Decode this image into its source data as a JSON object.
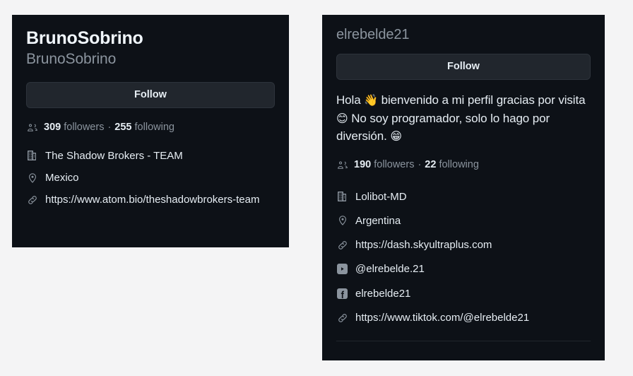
{
  "page": {
    "background_color": "#f4f4f5",
    "card_background_color": "#0d1117",
    "text_primary_color": "#e6edf3",
    "text_muted_color": "#8b949e"
  },
  "cards": [
    {
      "id": "brunosobrino",
      "display_name": "BrunoSobrino",
      "login_name": "BrunoSobrino",
      "follow_label": "Follow",
      "counts": {
        "followers_value": "309",
        "followers_label": "followers",
        "separator": "·",
        "following_value": "255",
        "following_label": "following"
      },
      "details": [
        {
          "icon": "organization-icon",
          "text": "The Shadow Brokers - TEAM"
        },
        {
          "icon": "location-icon",
          "text": "Mexico"
        },
        {
          "icon": "link-icon",
          "text": "https://www.atom.bio/theshadowbrokers-team"
        }
      ]
    },
    {
      "id": "elrebelde21",
      "login_name": "elrebelde21",
      "follow_label": "Follow",
      "bio": {
        "segment_1": "Hola ",
        "emoji_1": "👋",
        "segment_2": " bienvenido a mi perfil gracias por visita ",
        "emoji_2": "😊",
        "segment_3": " No soy programador, solo lo hago por diversión. ",
        "emoji_3": "😁"
      },
      "counts": {
        "followers_value": "190",
        "followers_label": "followers",
        "separator": "·",
        "following_value": "22",
        "following_label": "following"
      },
      "details": [
        {
          "icon": "organization-icon",
          "text": "Lolibot-MD"
        },
        {
          "icon": "location-icon",
          "text": "Argentina"
        },
        {
          "icon": "link-icon",
          "text": "https://dash.skyultraplus.com"
        },
        {
          "icon": "youtube-icon",
          "text": "@elrebelde.21"
        },
        {
          "icon": "facebook-icon",
          "text": "elrebelde21"
        },
        {
          "icon": "link-icon",
          "text": "https://www.tiktok.com/@elrebelde21"
        }
      ]
    }
  ]
}
